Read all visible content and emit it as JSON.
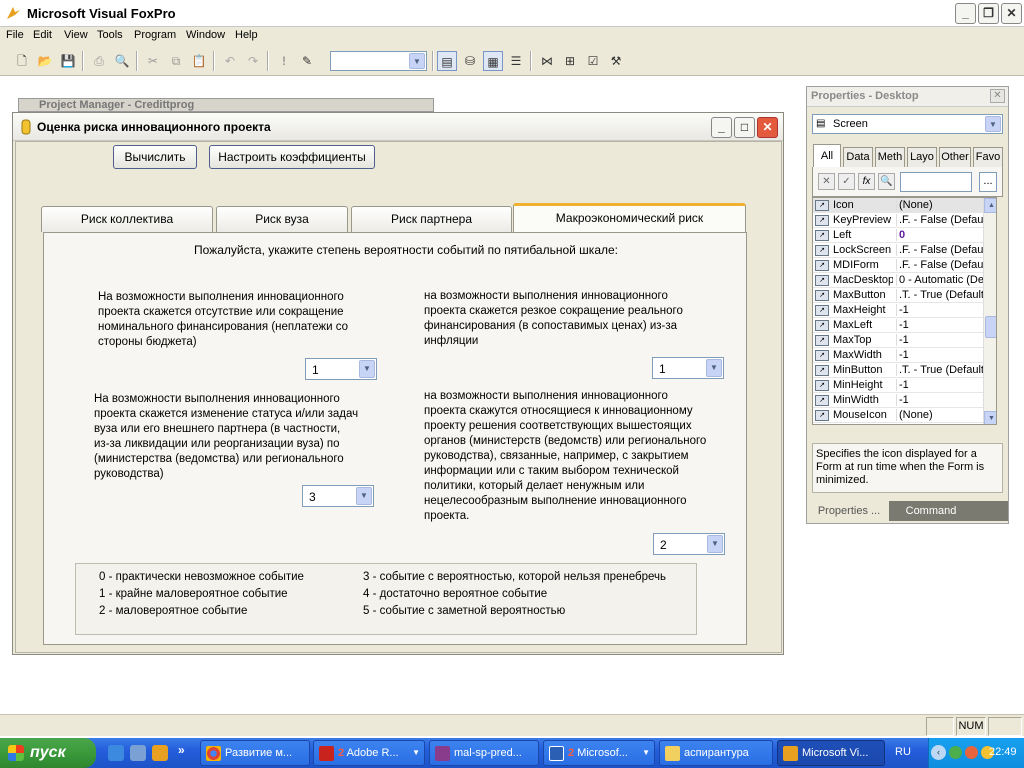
{
  "app": {
    "title": "Microsoft Visual FoxPro"
  },
  "menu": [
    "File",
    "Edit",
    "View",
    "Tools",
    "Program",
    "Window",
    "Help"
  ],
  "background_window": {
    "title": "Project Manager - Credittprog"
  },
  "form": {
    "title": "Оценка риска инновационного проекта",
    "buttons": {
      "calculate": "Вычислить",
      "configure": "Настроить коэффициенты"
    },
    "tabs": [
      "Риск коллектива",
      "Риск вуза",
      "Риск партнера",
      "Макроэкономический риск"
    ],
    "active_tab": 3,
    "instruction": "Пожалуйста, укажите степень вероятности событий по пятибальной шкале:",
    "questions": [
      {
        "lines": [
          "На возможности выполнения инновационного",
          "проекта скажется отсутствие или сокращение",
          "номинального финансирования (неплатежи со",
          "стороны бюджета)"
        ],
        "value": "1"
      },
      {
        "lines": [
          "на возможности выполнения инновационного",
          "проекта скажется резкое сокращение реального",
          "финансирования (в сопоставимых ценах) из-за",
          "инфляции"
        ],
        "value": "1"
      },
      {
        "lines": [
          "На возможности выполнения инновационного",
          "проекта скажется изменение статуса и/или задач",
          "вуза или его внешнего партнера (в частности,",
          "из-за ликвидации или реорганизации вуза) по",
          "(министерства (ведомства) или регионального",
          "руководства)"
        ],
        "value": "3"
      },
      {
        "lines": [
          "на возможности выполнения инновационного",
          "проекта скажутся относящиеся к инновационному",
          "проекту решения соответствующих вышестоящих",
          "органов (министерств (ведомств) или регионального",
          "руководства), связанные, например, с закрытием",
          "информации или с таким выбором технической",
          "политики, который делает ненужным или",
          "нецелесообразным выполнение инновационного",
          "проекта."
        ],
        "value": "2"
      }
    ],
    "legend": [
      "0 - практически невозможное событие",
      "1 - крайне маловероятное событие",
      "2 - маловероятное событие",
      "3 - событие с вероятностью, которой нельзя пренебречь",
      "4 - достаточно вероятное событие",
      "5 - событие с заметной вероятностью"
    ]
  },
  "properties": {
    "title": "Properties - Desktop",
    "object": "Screen",
    "tabs": [
      "All",
      "Data",
      "Methods",
      "Layout",
      "Other",
      "Favorites"
    ],
    "tabs_visible": [
      "All",
      "Data",
      "Meth",
      "Layo",
      "Other",
      "Favo"
    ],
    "rows": [
      {
        "name": "Icon",
        "value": "(None)"
      },
      {
        "name": "KeyPreview",
        "value": ".F. - False (Default)"
      },
      {
        "name": "Left",
        "value": "0"
      },
      {
        "name": "LockScreen",
        "value": ".F. - False (Default)"
      },
      {
        "name": "MDIForm",
        "value": ".F. - False (Default)"
      },
      {
        "name": "MacDesktop",
        "value": "0 - Automatic (Default)"
      },
      {
        "name": "MaxButton",
        "value": ".T. - True (Default)"
      },
      {
        "name": "MaxHeight",
        "value": "-1"
      },
      {
        "name": "MaxLeft",
        "value": "-1"
      },
      {
        "name": "MaxTop",
        "value": "-1"
      },
      {
        "name": "MaxWidth",
        "value": "-1"
      },
      {
        "name": "MinButton",
        "value": ".T. - True (Default)"
      },
      {
        "name": "MinHeight",
        "value": "-1"
      },
      {
        "name": "MinWidth",
        "value": "-1"
      },
      {
        "name": "MouseIcon",
        "value": "(None)"
      }
    ],
    "description": "Specifies the icon displayed for a Form at run time when the Form is minimized.",
    "bottom_tabs": [
      "Properties ...",
      "Command"
    ]
  },
  "status": {
    "num": "NUM"
  },
  "taskbar": {
    "start": "пуск",
    "tasks": [
      {
        "label": "Развитие м...",
        "count": ""
      },
      {
        "label": "Adobe R...",
        "count": "2"
      },
      {
        "label": "mal-sp-pred...",
        "count": ""
      },
      {
        "label": "Microsof...",
        "count": "2"
      },
      {
        "label": "аспирантура",
        "count": ""
      },
      {
        "label": "Microsoft Vi...",
        "count": ""
      }
    ],
    "lang": "RU",
    "clock": "22:49"
  },
  "colors": {
    "accent_tab": "#f0b030",
    "close_red": "#e45a3c",
    "taskbar_blue": "#245edb",
    "start_green": "#3a9a3a"
  }
}
